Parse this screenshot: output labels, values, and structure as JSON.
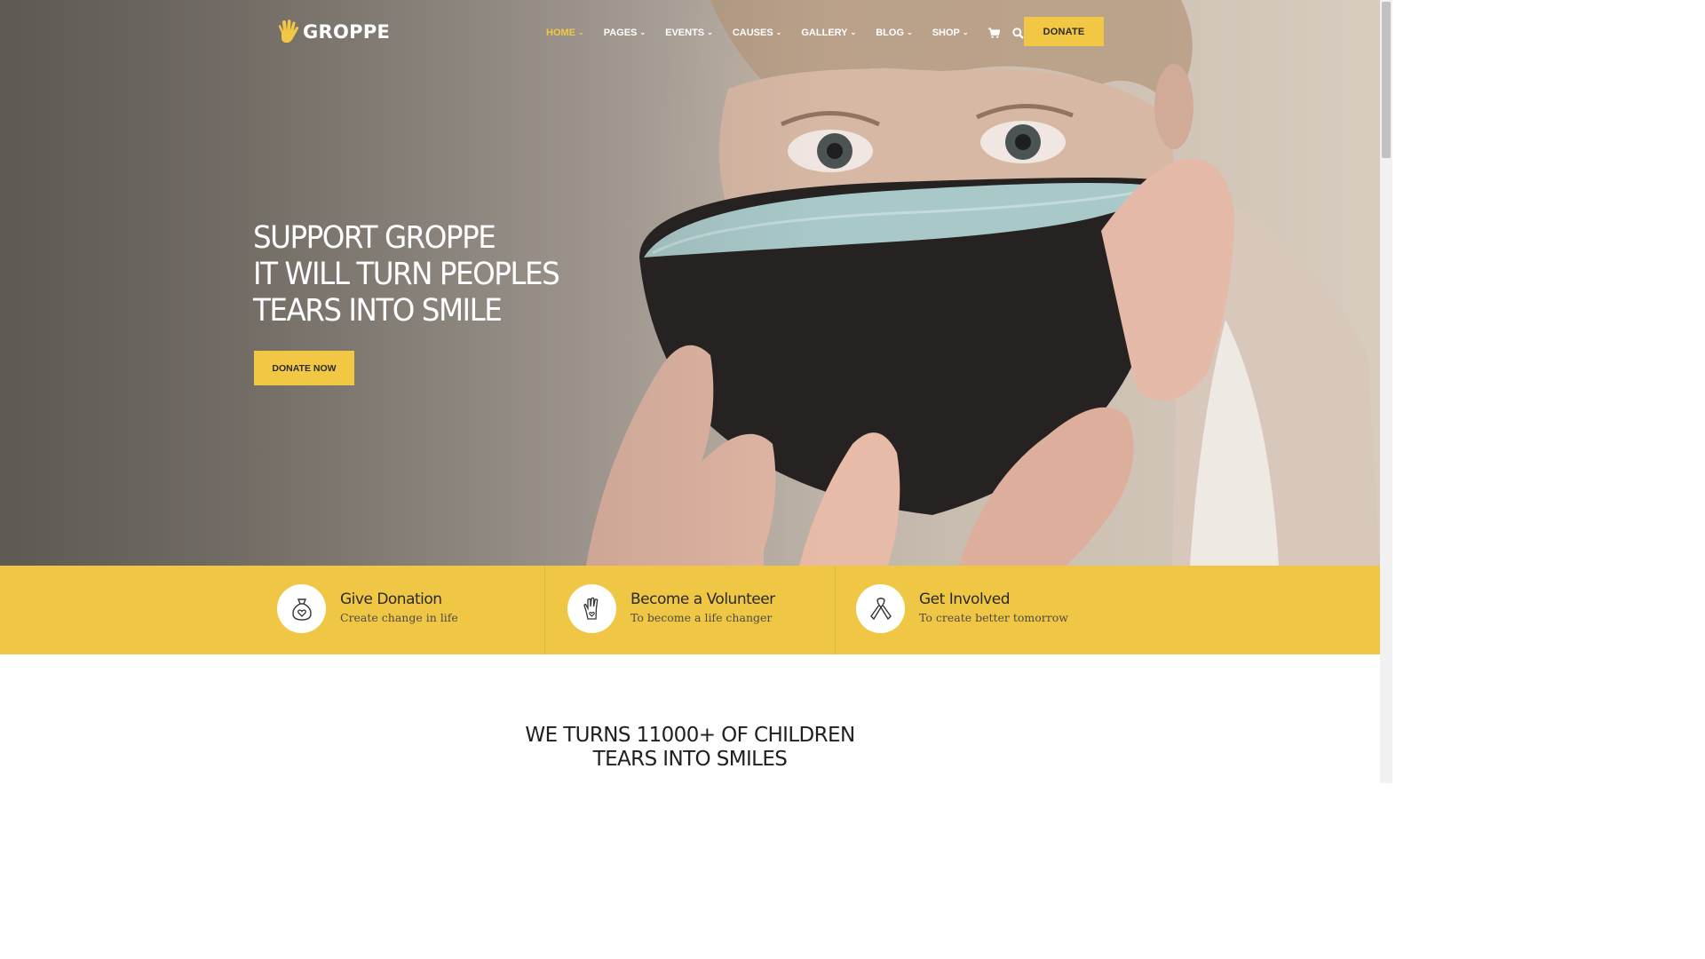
{
  "brand": {
    "name": "GROPPE",
    "accent_color": "#f1c744"
  },
  "nav": {
    "items": [
      {
        "label": "HOME",
        "active": true
      },
      {
        "label": "PAGES",
        "active": false
      },
      {
        "label": "EVENTS",
        "active": false
      },
      {
        "label": "CAUSES",
        "active": false
      },
      {
        "label": "GALLERY",
        "active": false
      },
      {
        "label": "BLOG",
        "active": false
      },
      {
        "label": "SHOP",
        "active": false
      }
    ],
    "cart_icon": "cart-icon",
    "search_icon": "search-icon",
    "donate_label": "DONATE"
  },
  "hero": {
    "lines": [
      "SUPPORT GROPPE",
      "IT WILL TURN PEOPLES",
      "TEARS INTO SMILE"
    ],
    "button_label": "DONATE NOW"
  },
  "features": [
    {
      "icon": "money-bag-heart-icon",
      "title": "Give Donation",
      "subtitle": "Create change in life"
    },
    {
      "icon": "hand-heart-icon",
      "title": "Become a Volunteer",
      "subtitle": "To become a life changer"
    },
    {
      "icon": "awareness-ribbon-icon",
      "title": "Get Involved",
      "subtitle": "To create better tomorrow"
    }
  ],
  "section": {
    "title_line1": "WE TURNS 11000+ OF CHILDREN",
    "title_line2": "TEARS INTO SMILES"
  }
}
